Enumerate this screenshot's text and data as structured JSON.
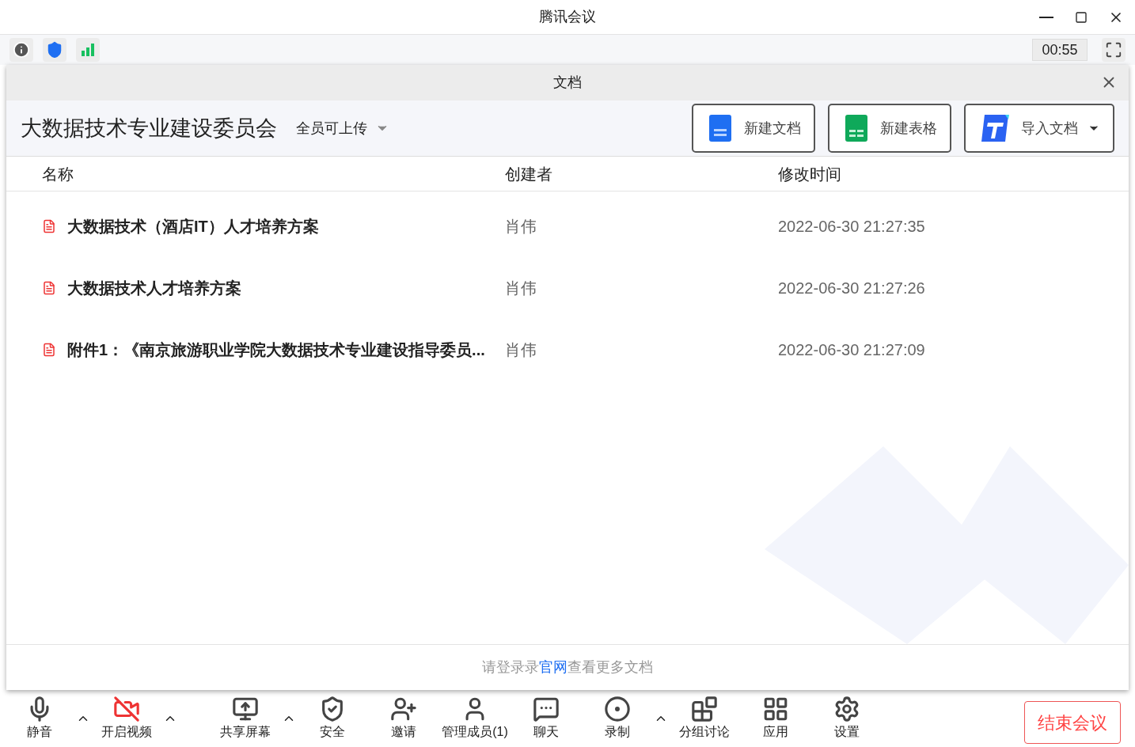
{
  "window": {
    "title": "腾讯会议"
  },
  "status": {
    "timer": "00:55"
  },
  "panel": {
    "title": "文档",
    "group_name": "大数据技术专业建设委员会",
    "permission": "全员可上传",
    "actions": [
      {
        "kind": "doc",
        "label": "新建文档"
      },
      {
        "kind": "sheet",
        "label": "新建表格"
      },
      {
        "kind": "import",
        "label": "导入文档"
      }
    ],
    "table": {
      "columns": [
        "名称",
        "创建者",
        "修改时间"
      ],
      "rows": [
        {
          "name": "大数据技术（酒店IT）人才培养方案",
          "creator": "肖伟",
          "modified": "2022-06-30 21:27:35"
        },
        {
          "name": "大数据技术人才培养方案",
          "creator": "肖伟",
          "modified": "2022-06-30 21:27:26"
        },
        {
          "name": "附件1：《南京旅游职业学院大数据技术专业建设指导委员...",
          "creator": "肖伟",
          "modified": "2022-06-30 21:27:09"
        }
      ]
    },
    "footer": {
      "before": "请登录录",
      "link": "官网",
      "after": "查看更多文档"
    }
  },
  "toolbar": [
    {
      "kind": "mic",
      "label": "静音",
      "menu": true
    },
    {
      "kind": "video",
      "label": "开启视频",
      "menu": true
    },
    {
      "kind": "share",
      "label": "共享屏幕",
      "menu": true
    },
    {
      "kind": "security",
      "label": "安全",
      "menu": false
    },
    {
      "kind": "invite",
      "label": "邀请",
      "menu": false
    },
    {
      "kind": "members",
      "label": "管理成员(1)",
      "menu": false
    },
    {
      "kind": "chat",
      "label": "聊天",
      "menu": false
    },
    {
      "kind": "record",
      "label": "录制",
      "menu": true
    },
    {
      "kind": "breakout",
      "label": "分组讨论",
      "menu": false
    },
    {
      "kind": "apps",
      "label": "应用",
      "menu": false
    },
    {
      "kind": "settings",
      "label": "设置",
      "menu": false
    }
  ],
  "end_button": "结束会议"
}
